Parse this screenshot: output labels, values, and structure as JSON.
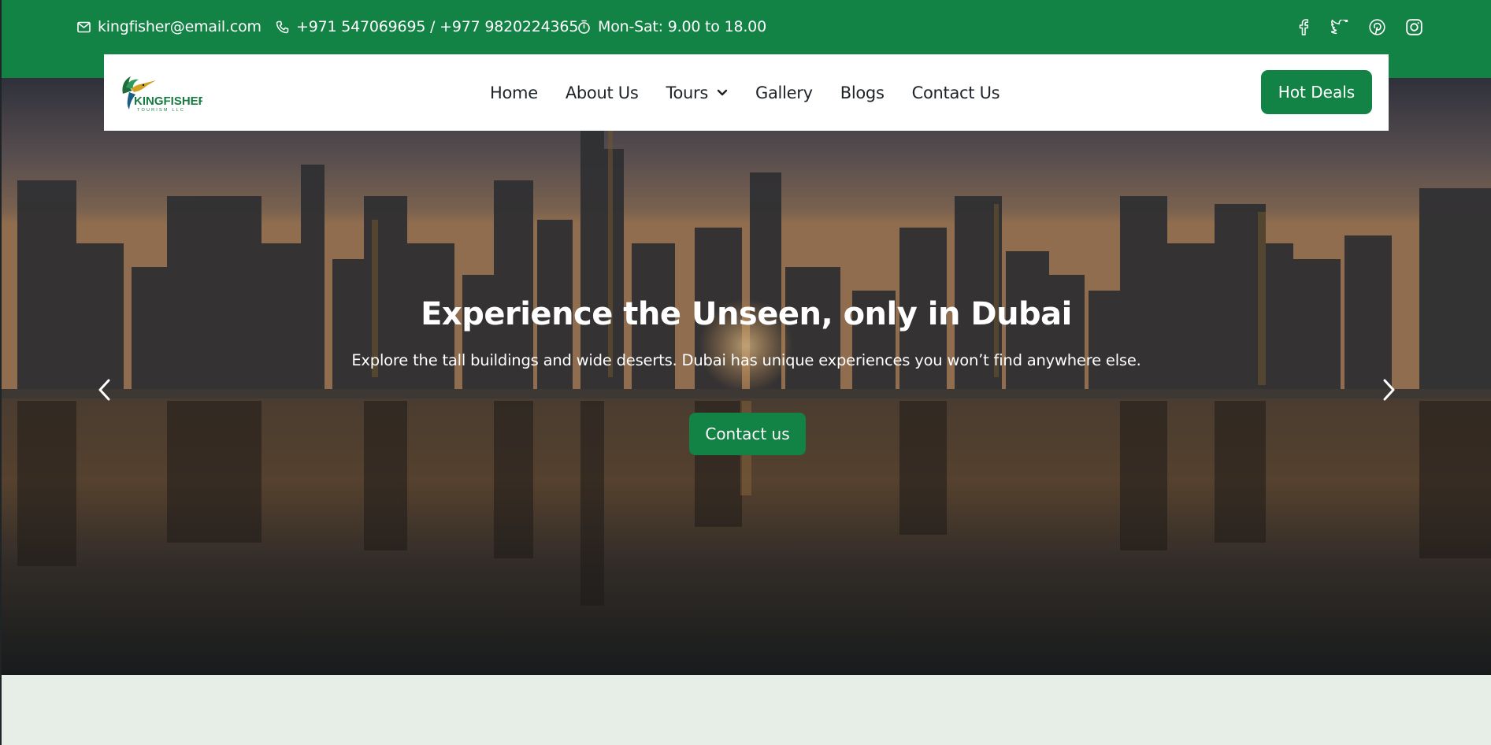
{
  "topbar": {
    "email": "kingfisher@email.com",
    "phone": "+971 547069695 / +977 9820224365",
    "hours": "Mon-Sat: 9.00 to 18.00",
    "social_icons": [
      "facebook-icon",
      "twitter-icon",
      "pinterest-icon",
      "instagram-icon"
    ]
  },
  "navbar": {
    "logo_text": "KINGFISHER",
    "logo_subtext": "TOURISM LLC",
    "items": [
      {
        "label": "Home"
      },
      {
        "label": "About Us"
      },
      {
        "label": "Tours"
      },
      {
        "label": "Gallery"
      },
      {
        "label": "Blogs"
      },
      {
        "label": "Contact Us"
      }
    ],
    "cta_label": "Hot Deals"
  },
  "hero": {
    "title": "Experience the Unseen, only in Dubai",
    "subtitle": "Explore the tall buildings and wide deserts. Dubai has unique experiences you won’t find anywhere else.",
    "button_label": "Contact us",
    "prev_icon": "chevron-left-icon",
    "next_icon": "chevron-right-icon"
  },
  "colors": {
    "brand_green": "#128245",
    "page_background": "#e7eee8",
    "nav_text": "#1d2327"
  }
}
